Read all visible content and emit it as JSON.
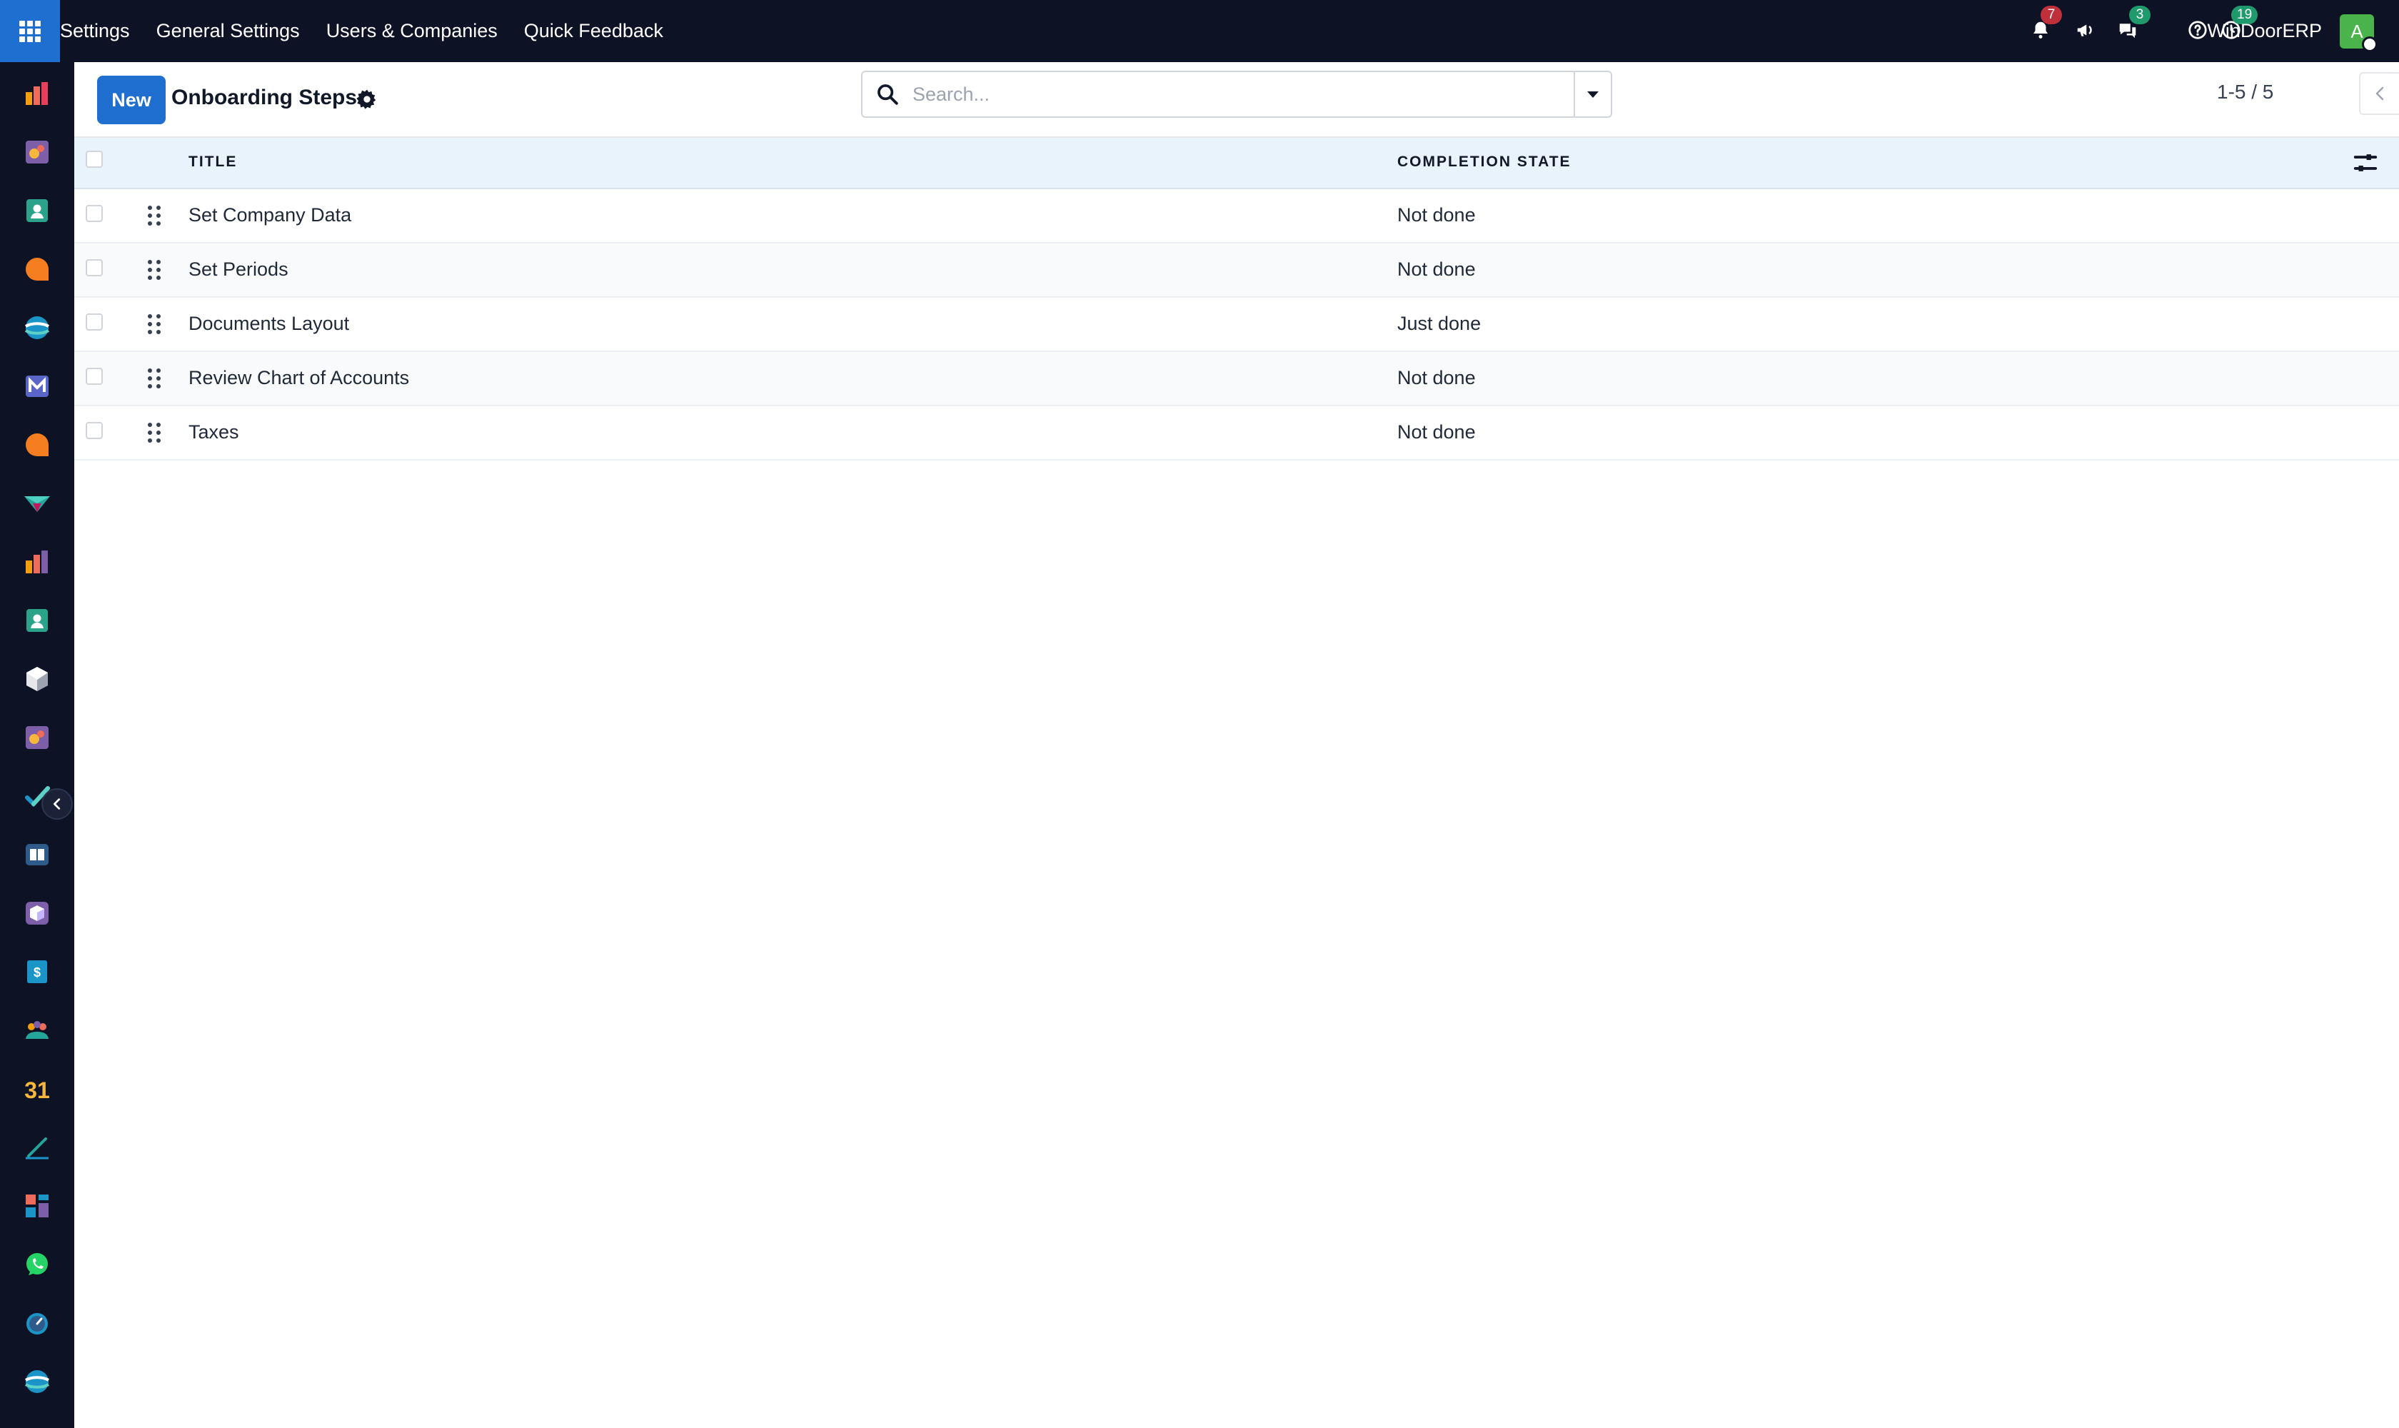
{
  "navbar": {
    "menu": [
      "Settings",
      "General Settings",
      "Users & Companies",
      "Quick Feedback"
    ],
    "notifications_count": "7",
    "messages_count": "3",
    "activities_count": "19",
    "company": "WinDoorERP",
    "avatar_letter": "A",
    "colors": {
      "bar": "#0e1225",
      "apps_button": "#1f6fd1",
      "badge_red": "#c0303b",
      "badge_green": "#1f9a6d"
    }
  },
  "sidebar": {
    "apps": [
      "discuss-icon",
      "marketing-icon",
      "contacts-icon",
      "chat-icon",
      "website-icon",
      "email-marketing-icon",
      "livechat-icon",
      "sales-icon",
      "crm-icon",
      "employees-icon",
      "inventory-icon",
      "appointments-icon",
      "todo-icon",
      "knowledge-icon",
      "product-icon",
      "invoicing-icon",
      "team-icon",
      "calendar-icon",
      "sign-icon",
      "dashboards-icon",
      "whatsapp-icon",
      "timer-icon",
      "survey-icon"
    ],
    "calendar_label": "31",
    "invoicing_label": "$"
  },
  "control_panel": {
    "new_label": "New",
    "title": "Onboarding Steps",
    "search_placeholder": "Search...",
    "pager": "1-5 / 5"
  },
  "table": {
    "columns": [
      "TITLE",
      "COMPLETION STATE"
    ],
    "rows": [
      {
        "title": "Set Company Data",
        "state": "Not done"
      },
      {
        "title": "Set Periods",
        "state": "Not done"
      },
      {
        "title": "Documents Layout",
        "state": "Just done"
      },
      {
        "title": "Review Chart of Accounts",
        "state": "Not done"
      },
      {
        "title": "Taxes",
        "state": "Not done"
      }
    ]
  }
}
